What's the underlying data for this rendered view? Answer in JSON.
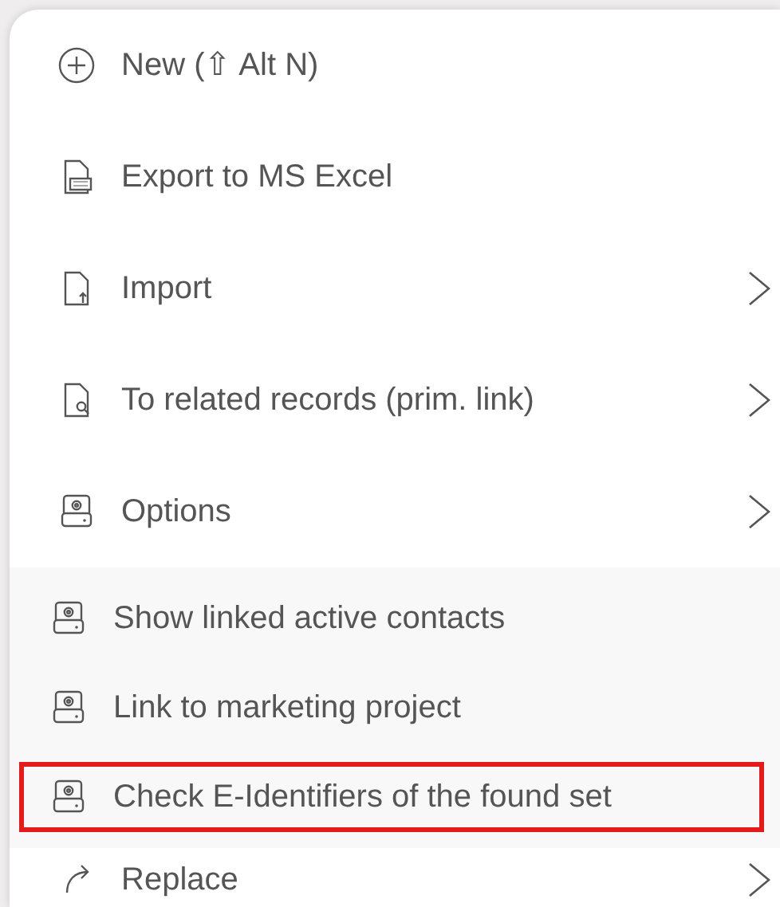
{
  "menu": {
    "items": [
      {
        "kind": "plus",
        "label": "New (⇧ Alt N)",
        "has_submenu": false
      },
      {
        "kind": "excel",
        "label": "Export to MS Excel",
        "has_submenu": false
      },
      {
        "kind": "import",
        "label": "Import",
        "has_submenu": true
      },
      {
        "kind": "related",
        "label": "To related records (prim. link)",
        "has_submenu": true
      },
      {
        "kind": "options",
        "label": "Options",
        "has_submenu": true,
        "expanded": true,
        "children": [
          {
            "label": "Show linked active contacts",
            "highlighted": false
          },
          {
            "label": "Link to marketing project",
            "highlighted": false
          },
          {
            "label": "Check E-Identifiers of the found set",
            "highlighted": true
          }
        ]
      },
      {
        "kind": "replace",
        "label": "Replace",
        "has_submenu": true
      }
    ]
  }
}
